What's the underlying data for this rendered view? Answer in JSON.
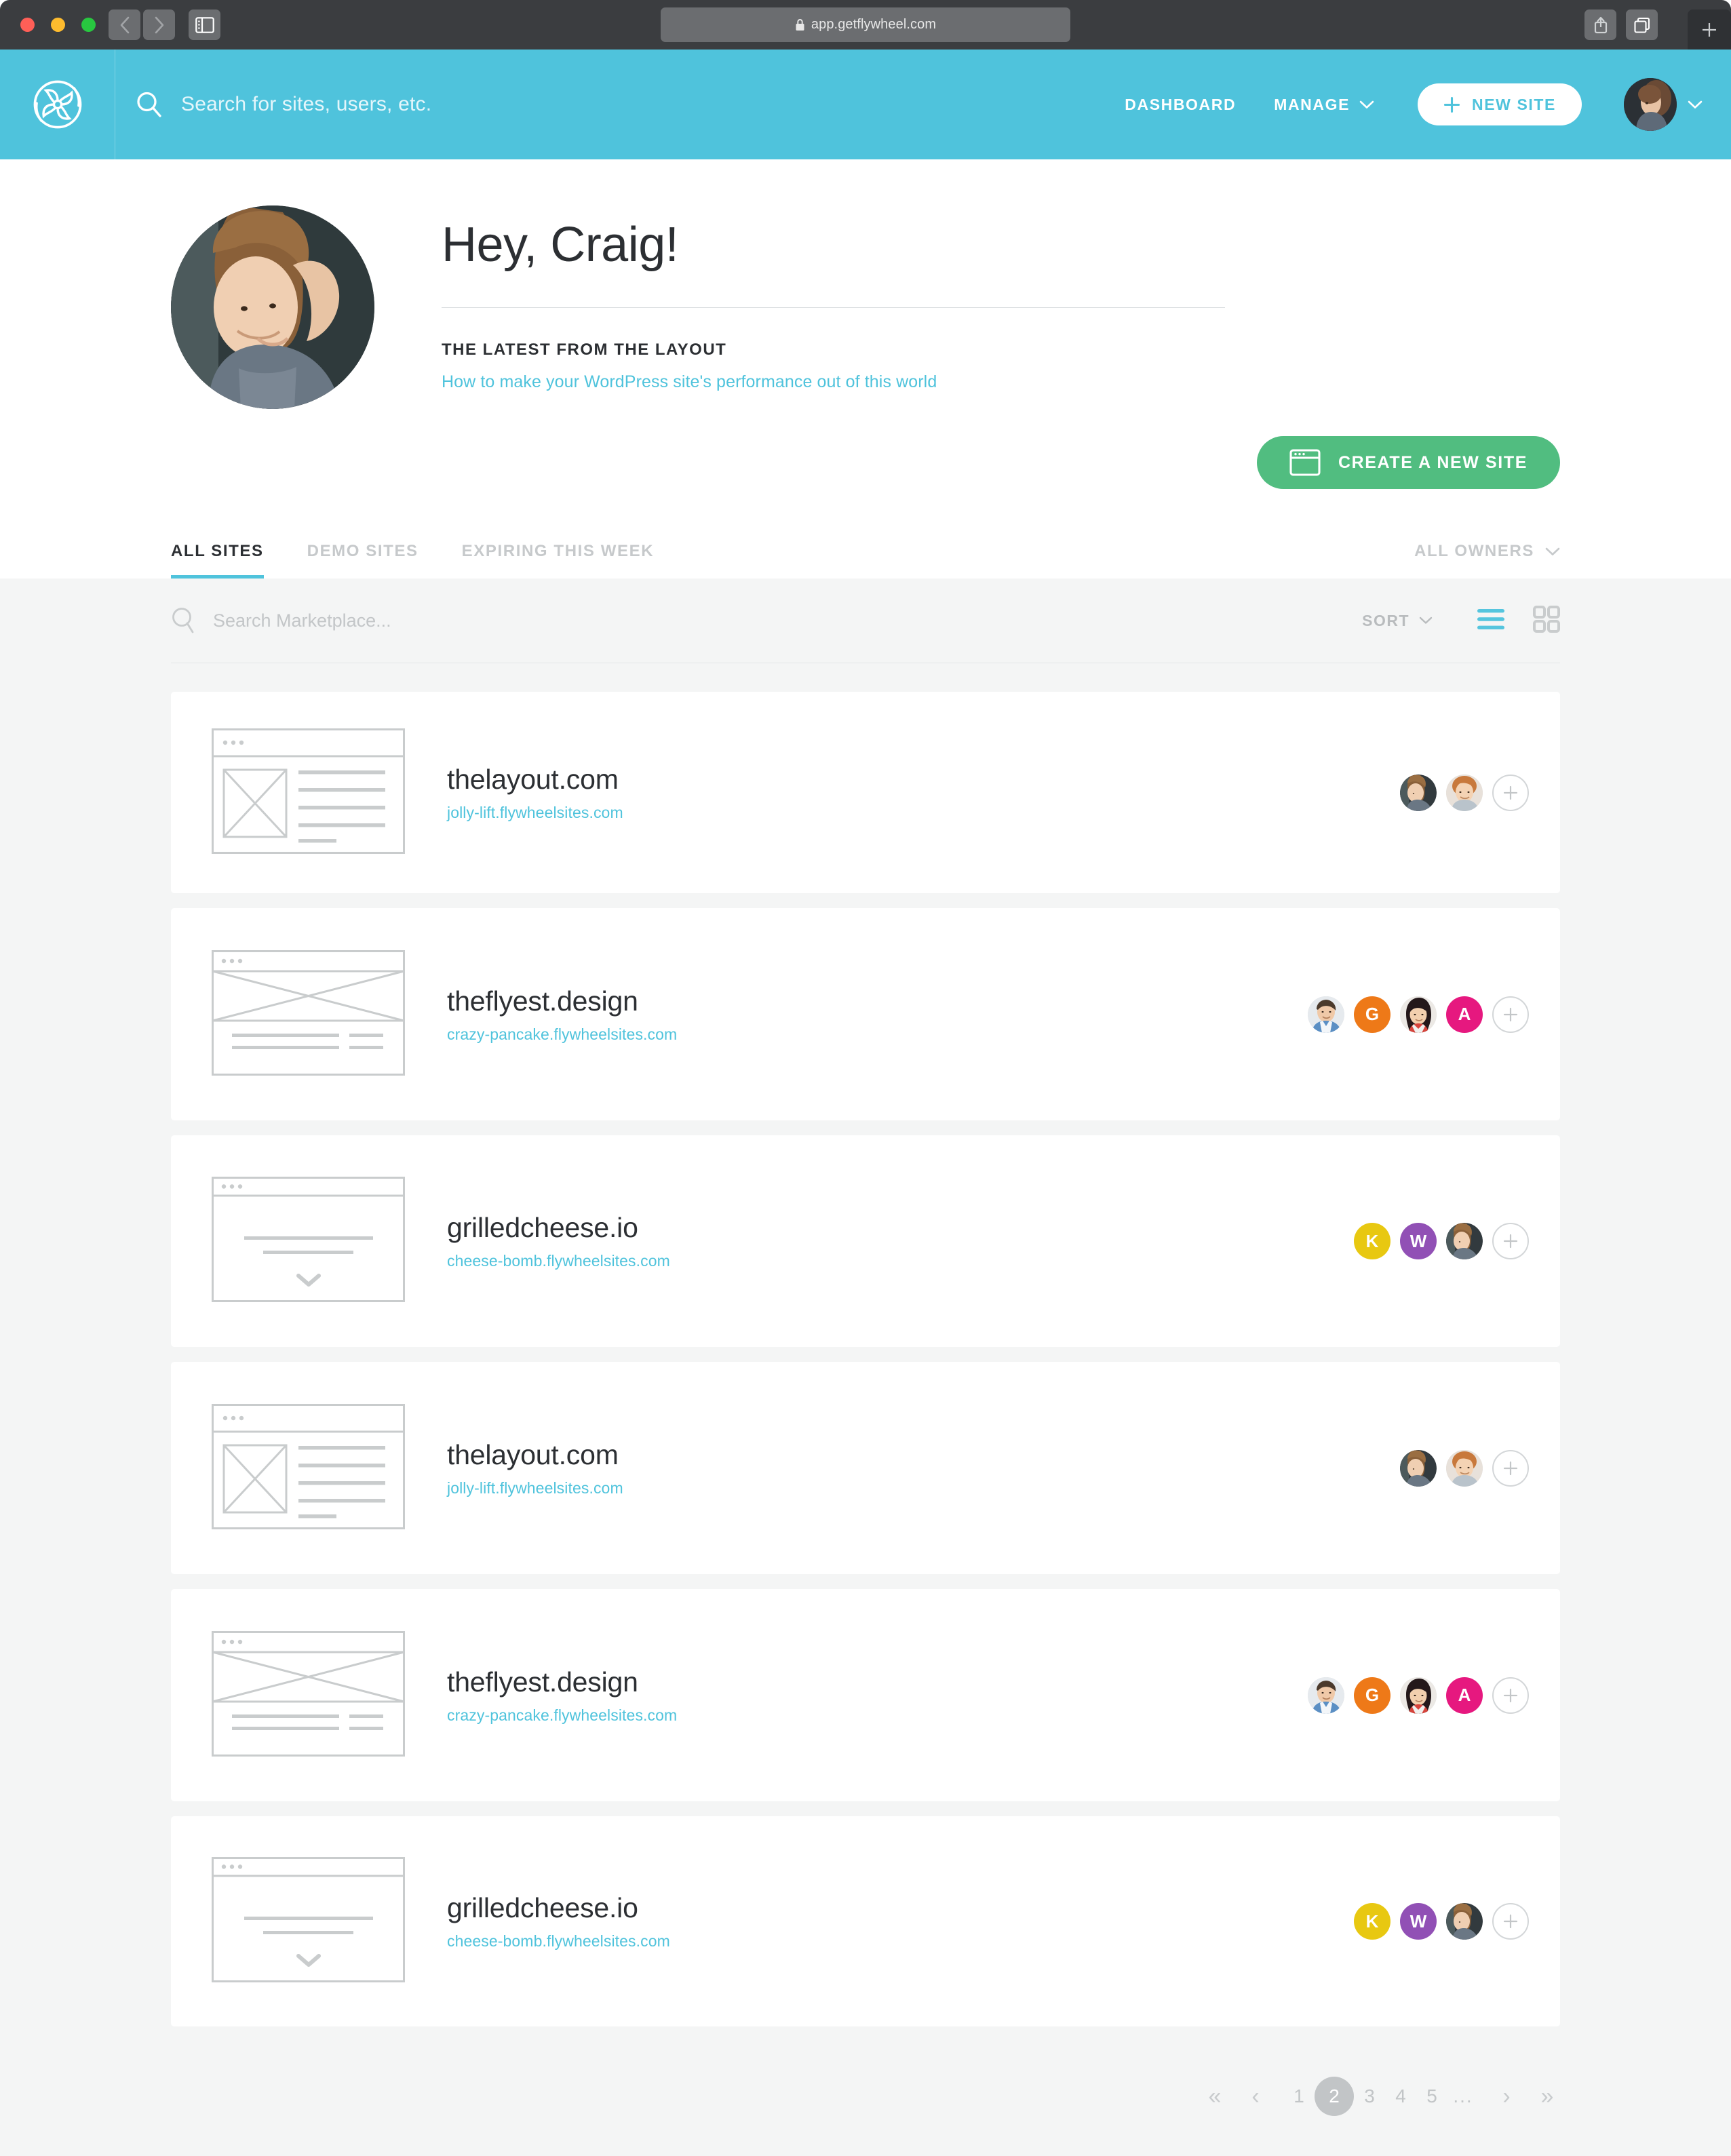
{
  "browser": {
    "url": "app.getflywheel.com",
    "lock_icon": "lock-icon",
    "back_icon": "chevron-left-icon",
    "forward_icon": "chevron-right-icon",
    "sidebar_icon": "sidebar-icon",
    "share_icon": "share-icon",
    "tabs_icon": "tabs-icon",
    "newtab_icon": "plus-icon"
  },
  "header": {
    "logo": "flywheel-logo-icon",
    "search_placeholder": "Search for sites, users, etc.",
    "search_icon": "search-icon",
    "nav": [
      {
        "label": "DASHBOARD",
        "has_caret": false
      },
      {
        "label": "MANAGE",
        "has_caret": true
      }
    ],
    "new_site_label": "NEW SITE",
    "new_site_icon": "plus-icon",
    "account_caret": "chevron-down-icon",
    "accent_color": "#4FC3DC"
  },
  "hero": {
    "greeting": "Hey, Craig!",
    "kicker": "THE LATEST FROM THE LAYOUT",
    "article_link": "How to make your WordPress site's performance out of this world",
    "create_button": {
      "label": "CREATE A NEW SITE",
      "icon": "browser-window-icon",
      "color": "#51BD80"
    }
  },
  "tabs": {
    "items": [
      {
        "label": "ALL SITES",
        "active": true
      },
      {
        "label": "DEMO SITES",
        "active": false
      },
      {
        "label": "EXPIRING THIS WEEK",
        "active": false
      }
    ],
    "owners_filter": {
      "label": "ALL OWNERS",
      "icon": "chevron-down-icon"
    }
  },
  "toolbar": {
    "search_placeholder": "Search Marketplace...",
    "search_value": "",
    "search_icon": "search-icon",
    "sort_label": "SORT",
    "sort_icon": "chevron-down-icon",
    "list_view_icon": "list-view-icon",
    "grid_view_icon": "grid-view-icon",
    "active_view": "list"
  },
  "sites": [
    {
      "title": "thelayout.com",
      "subdomain": "jolly-lift.flywheelsites.com",
      "thumb": "wireframe-sidebar-image",
      "collaborators": [
        {
          "type": "photo",
          "name": "craig-avatar",
          "bg": "#3a4045"
        },
        {
          "type": "photo",
          "name": "ginger-avatar",
          "bg": "#e8e0da"
        }
      ],
      "add_label": "+"
    },
    {
      "title": "theflyest.design",
      "subdomain": "crazy-pancake.flywheelsites.com",
      "thumb": "wireframe-hero-banner",
      "collaborators": [
        {
          "type": "photo",
          "name": "man-blue-shirt-avatar",
          "bg": "#e5e8ec"
        },
        {
          "type": "initial",
          "initial": "G",
          "bg": "#EE7918"
        },
        {
          "type": "photo",
          "name": "woman-dark-hair-avatar",
          "bg": "#ece9e6"
        },
        {
          "type": "initial",
          "initial": "A",
          "bg": "#E6187F"
        }
      ],
      "add_label": "+"
    },
    {
      "title": "grilledcheese.io",
      "subdomain": "cheese-bomb.flywheelsites.com",
      "thumb": "wireframe-centered-text",
      "collaborators": [
        {
          "type": "initial",
          "initial": "K",
          "bg": "#E8C811"
        },
        {
          "type": "initial",
          "initial": "W",
          "bg": "#9150B5"
        },
        {
          "type": "photo",
          "name": "craig-avatar",
          "bg": "#3a4045"
        }
      ],
      "add_label": "+"
    },
    {
      "title": "thelayout.com",
      "subdomain": "jolly-lift.flywheelsites.com",
      "thumb": "wireframe-sidebar-image",
      "collaborators": [
        {
          "type": "photo",
          "name": "craig-avatar",
          "bg": "#3a4045"
        },
        {
          "type": "photo",
          "name": "ginger-avatar",
          "bg": "#e8e0da"
        }
      ],
      "add_label": "+"
    },
    {
      "title": "theflyest.design",
      "subdomain": "crazy-pancake.flywheelsites.com",
      "thumb": "wireframe-hero-banner",
      "collaborators": [
        {
          "type": "photo",
          "name": "man-blue-shirt-avatar",
          "bg": "#e5e8ec"
        },
        {
          "type": "initial",
          "initial": "G",
          "bg": "#EE7918"
        },
        {
          "type": "photo",
          "name": "woman-dark-hair-avatar",
          "bg": "#ece9e6"
        },
        {
          "type": "initial",
          "initial": "A",
          "bg": "#E6187F"
        }
      ],
      "add_label": "+"
    },
    {
      "title": "grilledcheese.io",
      "subdomain": "cheese-bomb.flywheelsites.com",
      "thumb": "wireframe-centered-text",
      "collaborators": [
        {
          "type": "initial",
          "initial": "K",
          "bg": "#E8C811"
        },
        {
          "type": "initial",
          "initial": "W",
          "bg": "#9150B5"
        },
        {
          "type": "photo",
          "name": "craig-avatar",
          "bg": "#3a4045"
        }
      ],
      "add_label": "+"
    }
  ],
  "pagination": {
    "first": "«",
    "prev": "‹",
    "pages": [
      "1",
      "2",
      "3",
      "4",
      "5"
    ],
    "current": "2",
    "ellipsis": "...",
    "next": "›",
    "last": "»"
  }
}
